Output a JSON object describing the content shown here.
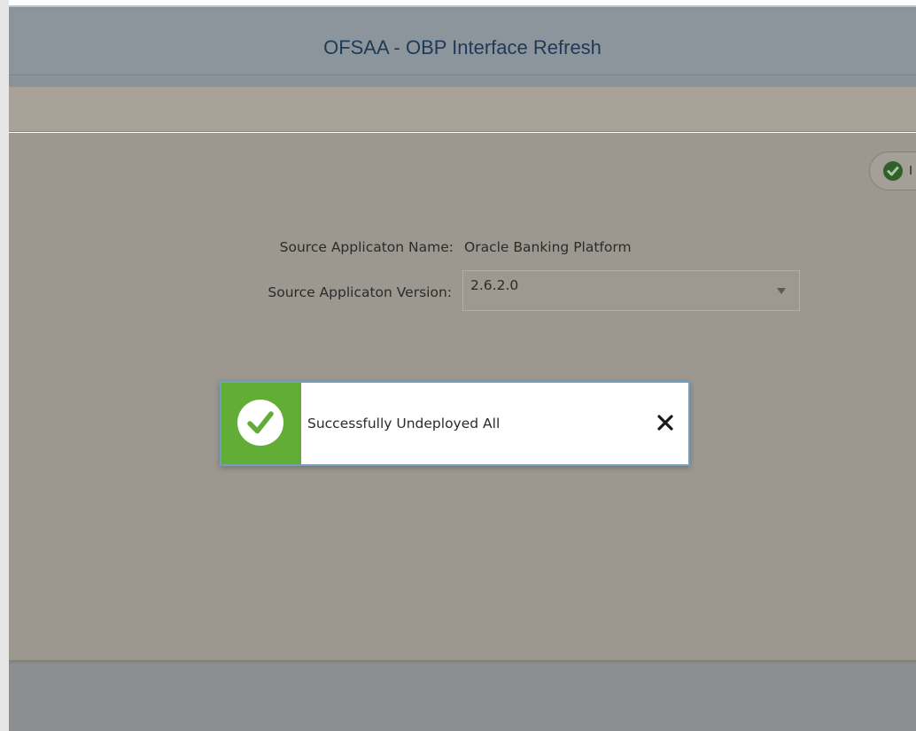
{
  "header": {
    "title": "OFSAA - OBP Interface Refresh"
  },
  "form": {
    "app_name_label": "Source Applicaton Name:",
    "app_name_value": "Oracle Banking Platform",
    "app_version_label": "Source Applicaton Version:",
    "app_version_value": "2.6.2.0"
  },
  "notification": {
    "message": "Successfully Undeployed All",
    "icon": "check-icon",
    "close_icon": "close-icon",
    "status_color": "#62ad36"
  },
  "top_right_button": {
    "icon": "check-circle-icon",
    "label": "I"
  }
}
